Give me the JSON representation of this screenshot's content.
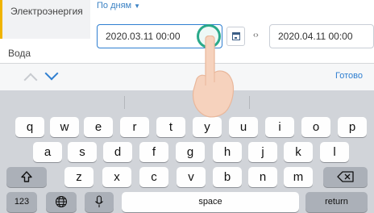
{
  "sidebar": {
    "active_item": "Электроэнергия",
    "next_item": "Вода"
  },
  "filter": {
    "period_label": "По дням",
    "start_date": "2020.03.11 00:00",
    "end_date": "2020.04.11 00:00",
    "separator": "‹›"
  },
  "accessory": {
    "done_label": "Готово"
  },
  "keyboard": {
    "row1": [
      "q",
      "w",
      "e",
      "r",
      "t",
      "y",
      "u",
      "i",
      "o",
      "p"
    ],
    "row2": [
      "a",
      "s",
      "d",
      "f",
      "g",
      "h",
      "j",
      "k",
      "l"
    ],
    "row3": [
      "z",
      "x",
      "c",
      "v",
      "b",
      "n",
      "m"
    ],
    "numbers_label": "123",
    "space_label": "space",
    "return_label": "return",
    "shift_icon": "shift-icon",
    "backspace_icon": "backspace-icon",
    "globe_icon": "globe-icon",
    "mic_icon": "microphone-icon"
  },
  "colors": {
    "accent_blue": "#2f7fd1",
    "sidebar_active_bar": "#f0b400",
    "focus_ring": "#2aa98a"
  }
}
